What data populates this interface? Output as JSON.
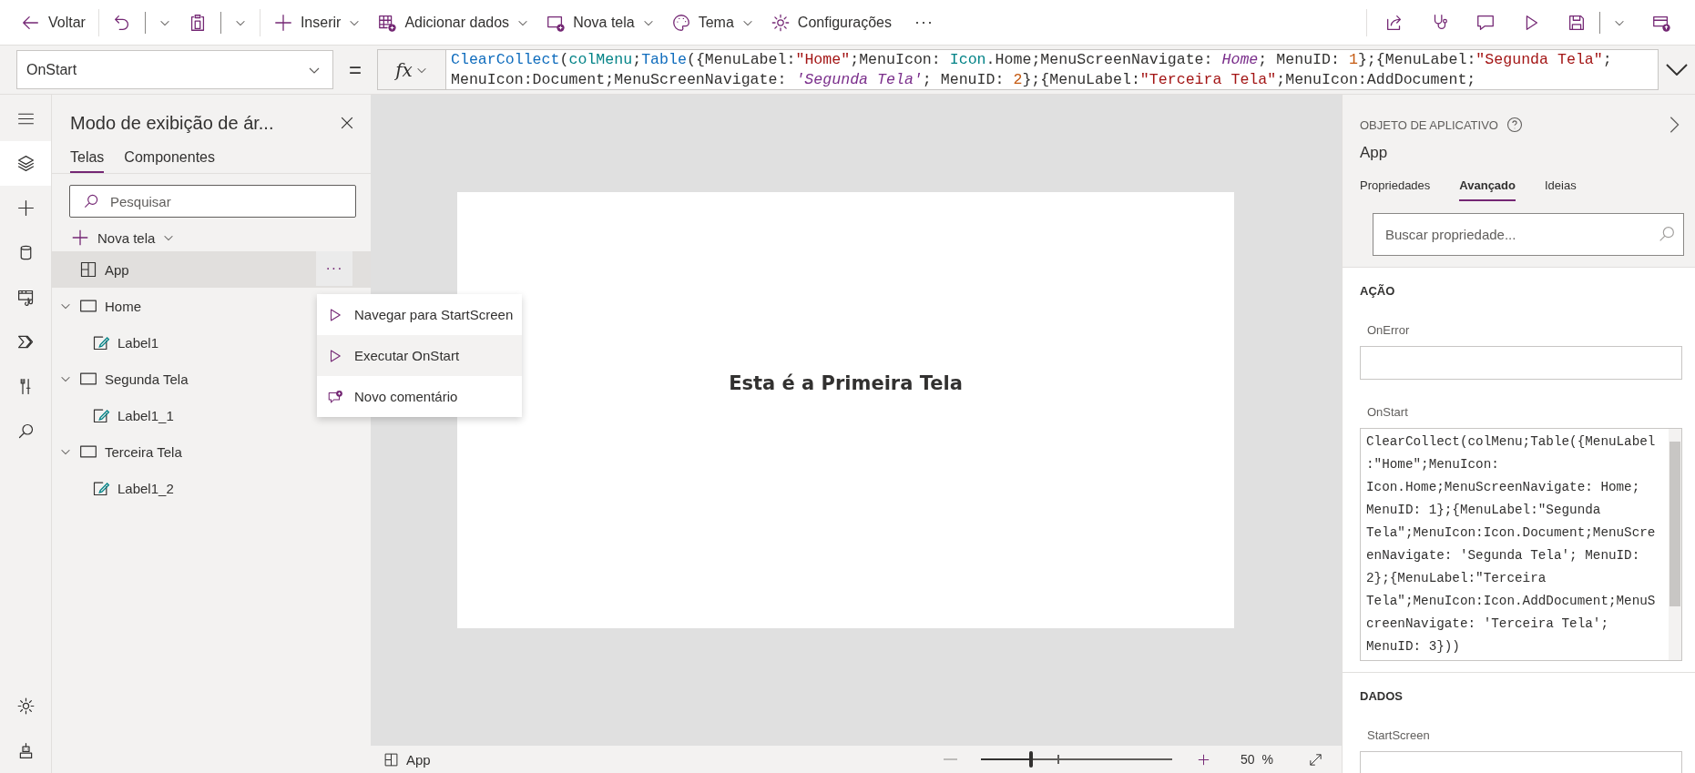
{
  "toolbar": {
    "left": [
      {
        "label": "Voltar",
        "dropdown": false
      },
      {
        "dropdown": true
      },
      {
        "dropdown": true
      },
      {
        "label": "Inserir",
        "dropdown": true
      },
      {
        "label": "Adicionar dados",
        "dropdown": true
      },
      {
        "label": "Nova tela",
        "dropdown": true
      },
      {
        "label": "Tema",
        "dropdown": true
      },
      {
        "label": "Configurações",
        "dropdown": false
      }
    ],
    "more": "···",
    "right": [
      {
        "dropdown": false
      },
      {
        "dropdown": false
      },
      {
        "dropdown": false
      },
      {
        "dropdown": false
      },
      {
        "dropdown": true
      },
      {
        "dropdown": false
      }
    ]
  },
  "formula_bar": {
    "property": "OnStart",
    "equals": "=",
    "fx": "fx",
    "lines": [
      [
        {
          "text": "ClearCollect",
          "kind": "fn"
        },
        {
          "text": "(",
          "kind": "plain"
        },
        {
          "text": "colMenu",
          "kind": "var"
        },
        {
          "text": ";",
          "kind": "plain"
        },
        {
          "text": "Table",
          "kind": "fn"
        },
        {
          "text": "({MenuLabel:",
          "kind": "plain"
        },
        {
          "text": "\"Home\"",
          "kind": "str"
        },
        {
          "text": ";MenuIcon: ",
          "kind": "plain"
        },
        {
          "text": "Icon",
          "kind": "var"
        },
        {
          "text": ".Home;MenuScreenNavigate: ",
          "kind": "plain"
        },
        {
          "text": "Home",
          "kind": "screen"
        },
        {
          "text": "; MenuID: ",
          "kind": "plain"
        },
        {
          "text": "1",
          "kind": "num"
        },
        {
          "text": "};{MenuLabel:",
          "kind": "plain"
        },
        {
          "text": "\"Segunda Tela\"",
          "kind": "str"
        },
        {
          "text": ";",
          "kind": "plain"
        }
      ],
      [
        {
          "text": "MenuIcon:Document;MenuScreenNavigate: ",
          "kind": "plain"
        },
        {
          "text": "'Segunda Tela'",
          "kind": "screen"
        },
        {
          "text": "; MenuID: ",
          "kind": "plain"
        },
        {
          "text": "2",
          "kind": "num"
        },
        {
          "text": "};{MenuLabel:",
          "kind": "plain"
        },
        {
          "text": "\"Terceira Tela\"",
          "kind": "str"
        },
        {
          "text": ";MenuIcon:AddDocument;",
          "kind": "plain"
        }
      ]
    ]
  },
  "rail": {
    "top": [
      {
        "selected": false
      },
      {
        "selected": true
      },
      {
        "selected": false
      },
      {
        "selected": false
      },
      {
        "selected": false
      },
      {
        "selected": false
      },
      {
        "selected": false
      },
      {
        "selected": false
      }
    ],
    "bottom": [
      {
        "selected": false
      },
      {
        "selected": false
      }
    ]
  },
  "tree_panel": {
    "title": "Modo de exibição de ár...",
    "tabs": [
      {
        "label": "Telas",
        "selected": true
      },
      {
        "label": "Componentes",
        "selected": false
      }
    ],
    "search": {
      "placeholder": "Pesquisar"
    },
    "new_screen": "Nova tela",
    "items": [
      {
        "label": "App",
        "kind": "app",
        "selected": true,
        "more": "···"
      },
      {
        "label": "Home",
        "kind": "screen",
        "selected": false,
        "expanded": true,
        "children": [
          {
            "label": "Label1",
            "kind": "label",
            "selected": false
          }
        ]
      },
      {
        "label": "Segunda Tela",
        "kind": "screen",
        "selected": false,
        "expanded": true,
        "children": [
          {
            "label": "Label1_1",
            "kind": "label",
            "selected": false
          }
        ]
      },
      {
        "label": "Terceira Tela",
        "kind": "screen",
        "selected": false,
        "expanded": true,
        "children": [
          {
            "label": "Label1_2",
            "kind": "label",
            "selected": false
          }
        ]
      }
    ]
  },
  "context_menu": [
    {
      "label": "Navegar para StartScreen",
      "kind": "play",
      "highlighted": false
    },
    {
      "label": "Executar OnStart",
      "kind": "play",
      "highlighted": true
    },
    {
      "label": "Novo comentário",
      "kind": "comment",
      "highlighted": false
    }
  ],
  "canvas": {
    "screen_label": "Esta é a Primeira Tela",
    "footer": {
      "selection": "App",
      "zoom": {
        "level": 0.26,
        "value": "50",
        "unit": "%"
      }
    }
  },
  "properties_panel": {
    "section_label": "OBJETO DE APLICATIVO",
    "name": "App",
    "tabs": [
      {
        "label": "Propriedades",
        "selected": false
      },
      {
        "label": "Avançado",
        "selected": true
      },
      {
        "label": "Ideias",
        "selected": false
      }
    ],
    "search": {
      "placeholder": "Buscar propriedade..."
    },
    "sections": [
      {
        "title": "AÇÃO",
        "properties": [
          {
            "name": "OnError",
            "kind": "field"
          },
          {
            "name": "OnStart",
            "kind": "code",
            "lines": [
              "ClearCollect(colMenu;Table({MenuLabel",
              ":\"Home\";MenuIcon:",
              "Icon.Home;MenuScreenNavigate: Home;",
              "MenuID: 1};{MenuLabel:\"Segunda",
              "Tela\";MenuIcon:Icon.Document;MenuScre",
              "enNavigate: 'Segunda Tela'; MenuID:",
              "2};{MenuLabel:\"Terceira",
              "Tela\";MenuIcon:Icon.AddDocument;MenuS",
              "creenNavigate: 'Terceira Tela';",
              "MenuID: 3}))"
            ]
          }
        ]
      },
      {
        "title": "DADOS",
        "properties": [
          {
            "name": "StartScreen",
            "kind": "field"
          }
        ]
      }
    ]
  }
}
